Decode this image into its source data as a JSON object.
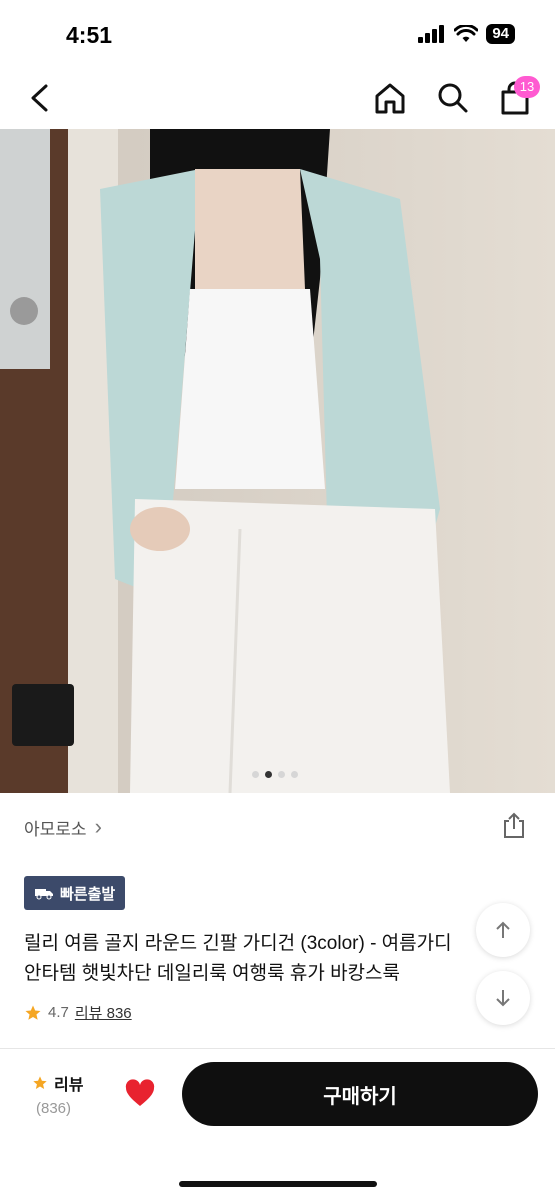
{
  "status_bar": {
    "time": "4:51",
    "battery": "94"
  },
  "nav": {
    "cart_count": "13",
    "icons": [
      "back-icon",
      "home-icon",
      "search-icon",
      "shopping-bag-icon"
    ]
  },
  "product_image": {
    "dots_count": 4,
    "active_dot": 1
  },
  "seller": {
    "name": "아모로소",
    "chevron": "›"
  },
  "badge": {
    "label": "빠른출발"
  },
  "product": {
    "title_line1": "릴리 여름 골지 라운드 긴팔 가디건 (3color) - 여름가디",
    "title_line2": "안타템 햇빛차단 데일리룩 여행룩 휴가 바캉스룩"
  },
  "rating": {
    "score": "4.7",
    "review_link": "리뷰 836"
  },
  "bottom_bar": {
    "review_label": "리뷰",
    "review_count": "(836)",
    "buy_label": "구매하기"
  },
  "colors": {
    "accent_badge": "#ff5ad1",
    "badge_bg": "#3c4a6a",
    "star": "#f5a623",
    "heart": "#e8232f",
    "buy_bg": "#0f0f0f"
  }
}
